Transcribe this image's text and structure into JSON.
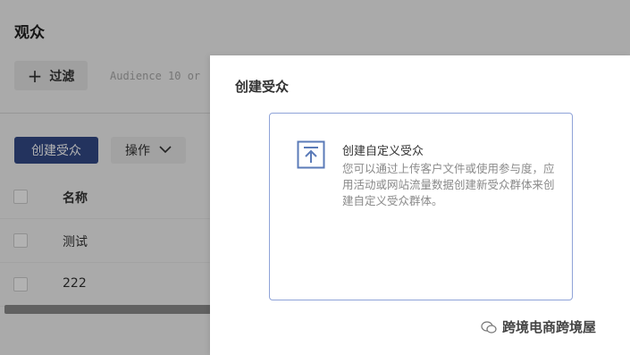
{
  "page": {
    "title": "观众"
  },
  "toolbar": {
    "filter_label": "过滤",
    "search_placeholder": "Audience 10 or"
  },
  "actions": {
    "create_label": "创建受众",
    "more_label": "操作"
  },
  "table": {
    "header": "名称",
    "rows": [
      "测试",
      "222"
    ]
  },
  "modal": {
    "title": "创建受众",
    "option": {
      "title": "创建自定义受众",
      "description": "您可以通过上传客户文件或使用参与度，应用活动或网站流量数据创建新受众群体来创建自定义受众群体。"
    }
  },
  "watermark": {
    "text": "跨境电商跨境屋"
  },
  "colors": {
    "primary": "#334a87",
    "card_border": "#8fa3d8",
    "icon": "#5b7bb8"
  }
}
